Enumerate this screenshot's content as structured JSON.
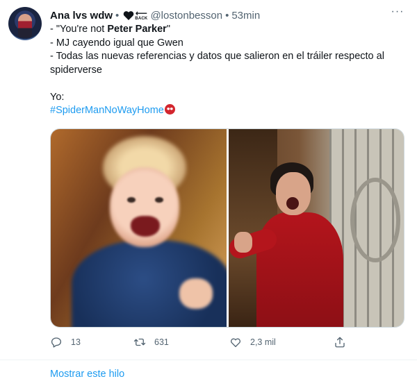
{
  "tweet": {
    "author_name": "Ana lvs wdw",
    "separator": "•",
    "back_label": "BACK",
    "back_arrow": "⟵",
    "handle": "@lostonbesson",
    "time": "53min",
    "more": "···",
    "lines": {
      "l1_prefix": "- \"You're not ",
      "l1_bold": "Peter Parker",
      "l1_suffix": "\"",
      "l2": "- MJ cayendo igual que Gwen",
      "l3": "- Todas las nuevas referencias y datos que salieron en el tráiler respecto al",
      "l4": "spiderverse",
      "l5": "Yo:",
      "hashtag": "#SpiderManNoWayHome"
    }
  },
  "actions": {
    "reply_count": "13",
    "retweet_count": "631",
    "like_count": "2,3 mil"
  },
  "show_thread_label": "Mostrar este hilo",
  "colors": {
    "accent": "#1d9bf0",
    "muted": "#536471",
    "text": "#0f1419"
  }
}
